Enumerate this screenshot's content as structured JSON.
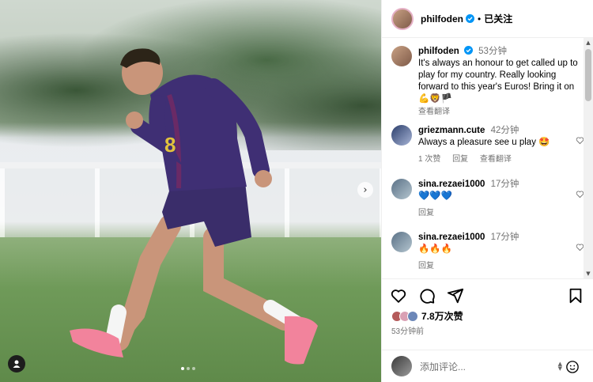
{
  "post": {
    "author": "philfoden",
    "follow_status": "已关注",
    "caption": "It's always an honour to get called up to play for my country. Really looking forward to this year's Euros! Bring it on 💪🦁🏴",
    "caption_time": "53分钟",
    "see_translation": "查看翻译",
    "likes": "7.8万次赞",
    "posted": "53分钟前",
    "image_dots": 3,
    "image_dot_active": 1
  },
  "comments": [
    {
      "user": "griezmann.cute",
      "time": "42分钟",
      "text": "Always a pleasure see u play 🤩",
      "likes": "1 次赞",
      "reply": "回复",
      "translate": "查看翻译"
    },
    {
      "user": "sina.rezaei1000",
      "time": "17分钟",
      "text": "💙💙💙",
      "reply": "回复"
    },
    {
      "user": "sina.rezaei1000",
      "time": "17分钟",
      "text": "🔥🔥🔥",
      "reply": "回复"
    }
  ],
  "add_comment": {
    "placeholder": "添加评论..."
  },
  "icons": {
    "verified": "verified-badge-icon",
    "like": "heart-icon",
    "comment": "comment-icon",
    "share": "share-icon",
    "save": "bookmark-icon",
    "emoji": "emoji-icon",
    "next": "chevron-right-icon",
    "user_tag": "user-tag-icon"
  },
  "colors": {
    "verified": "#0095f6",
    "secondary_text": "#737373",
    "divider": "#efefef"
  }
}
